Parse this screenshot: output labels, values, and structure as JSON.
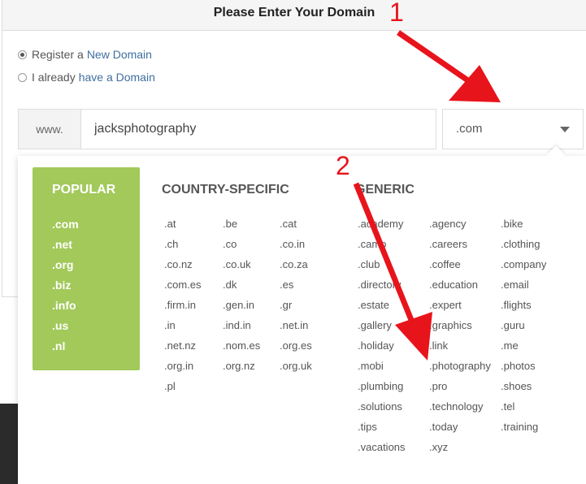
{
  "header": {
    "title": "Please Enter Your Domain"
  },
  "options": {
    "register": {
      "prefix": "Register a",
      "link": "New Domain"
    },
    "existing": {
      "prefix": "I already",
      "link": "have a Domain"
    }
  },
  "domain_form": {
    "prefix": "www.",
    "value": "jacksphotography",
    "tld_selected": ".com"
  },
  "dropdown": {
    "popular": {
      "heading": "POPULAR",
      "items": [
        ".com",
        ".net",
        ".org",
        ".biz",
        ".info",
        ".us",
        ".nl"
      ]
    },
    "country": {
      "heading": "COUNTRY-SPECIFIC",
      "items": [
        ".at",
        ".be",
        ".cat",
        ".ch",
        ".co",
        ".co.in",
        ".co.nz",
        ".co.uk",
        ".co.za",
        ".com.es",
        ".dk",
        ".es",
        ".firm.in",
        ".gen.in",
        ".gr",
        ".in",
        ".ind.in",
        ".net.in",
        ".net.nz",
        ".nom.es",
        ".org.es",
        ".org.in",
        ".org.nz",
        ".org.uk",
        ".pl"
      ]
    },
    "generic": {
      "heading": "GENERIC",
      "items": [
        ".academy",
        ".agency",
        ".bike",
        ".camp",
        ".careers",
        ".clothing",
        ".club",
        ".coffee",
        ".company",
        ".directory",
        ".education",
        ".email",
        ".estate",
        ".expert",
        ".flights",
        ".gallery",
        ".graphics",
        ".guru",
        ".holiday",
        ".link",
        ".me",
        ".mobi",
        ".photography",
        ".photos",
        ".plumbing",
        ".pro",
        ".shoes",
        ".solutions",
        ".technology",
        ".tel",
        ".tips",
        ".today",
        ".training",
        ".vacations",
        ".xyz"
      ]
    }
  },
  "annotations": {
    "one": "1",
    "two": "2",
    "color": "#e8141c"
  }
}
